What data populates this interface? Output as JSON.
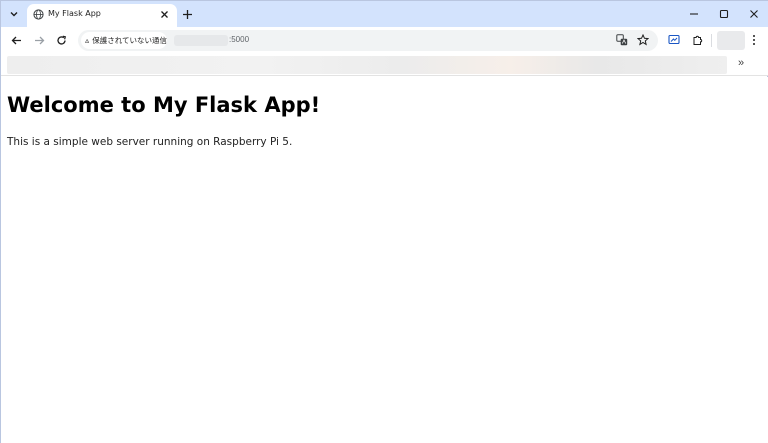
{
  "browser": {
    "tab": {
      "title": "My Flask App"
    },
    "address_bar": {
      "security_chip": "保護されていない通信",
      "url_suffix": ":5000"
    },
    "bookmarks": {
      "overflow": "»"
    }
  },
  "page": {
    "heading": "Welcome to My Flask App!",
    "body_text": "This is a simple web server running on Raspberry Pi 5."
  },
  "icons": {
    "tab_search": "chevron-down-icon",
    "favicon": "globe-icon",
    "tab_close": "close-icon",
    "new_tab": "plus-icon",
    "back": "arrow-left-icon",
    "forward": "arrow-right-icon",
    "reload": "reload-icon",
    "warning": "warning-icon",
    "translate": "translate-icon",
    "bookmark": "star-icon",
    "cast": "cast-icon",
    "extensions": "puzzle-icon",
    "menu": "kebab-icon"
  },
  "colors": {
    "tab_strip": "#d3e3fd",
    "omnibox": "#f1f3f4",
    "heading": "#000000"
  }
}
